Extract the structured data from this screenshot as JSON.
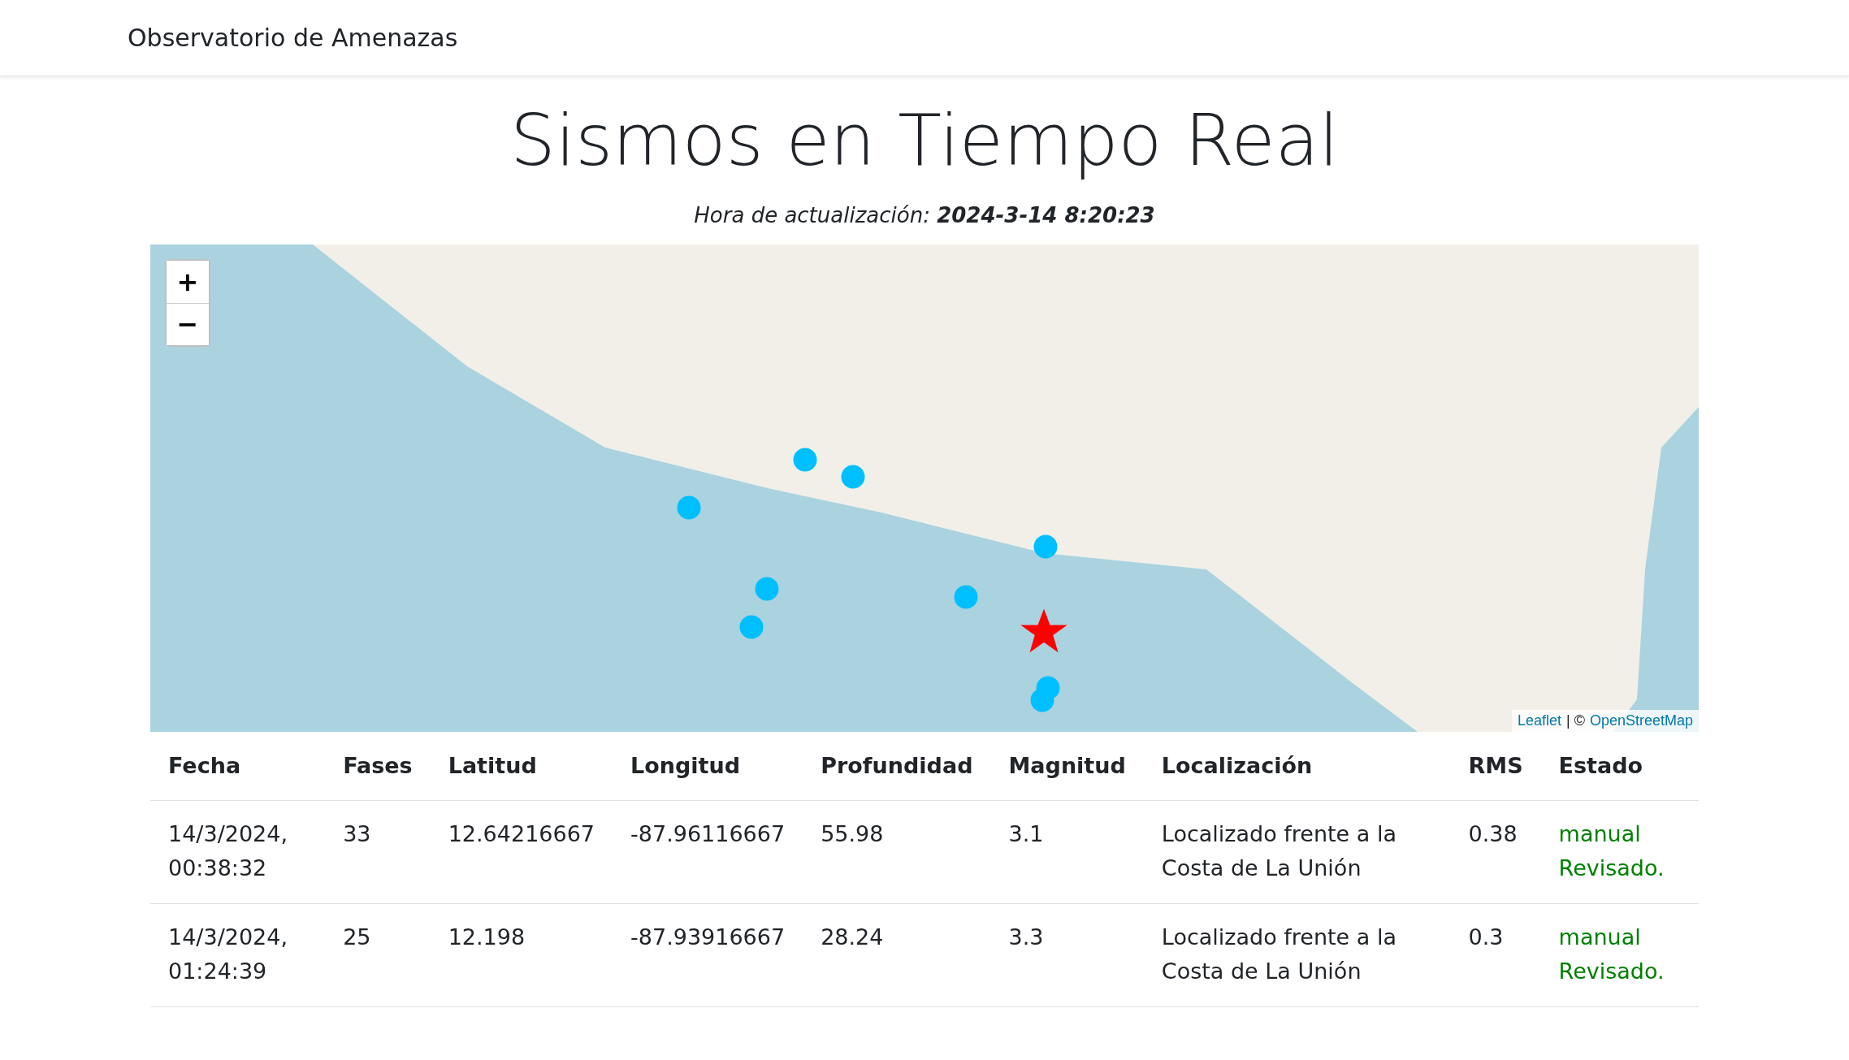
{
  "navbar": {
    "brand": "Observatorio de Amenazas"
  },
  "title": "Sismos en Tiempo Real",
  "update_time": "Hora de actualización: **2024-3-14 8:20:23**",
  "map": {
    "zoom_in": "+",
    "zoom_out": "−",
    "attribution": {
      "leaflet": "Leaflet",
      "separator": "| ©",
      "osm": "OpenStreetMap"
    }
  },
  "table": {
    "columns": [
      "Fecha",
      "Fases",
      "Latitud",
      "Longitud",
      "Profundidad",
      "Magnitud",
      "Localización",
      "RMS",
      "Estado"
    ],
    "rows": [
      [
        "14/3/2024, 00:38:32",
        "33",
        "12.64216667",
        "-87.96116667",
        "55.98",
        "3.1",
        "Localizado frente a la Costa de La Unión",
        "0.38",
        "manual Revisado."
      ],
      [
        "14/3/2024, 01:24:39",
        "25",
        "12.198",
        "-87.93916667",
        "28.24",
        "3.3",
        "Localizado frente a la Costa de La Unión",
        "0.3",
        "manual Revisado."
      ]
    ]
  }
}
